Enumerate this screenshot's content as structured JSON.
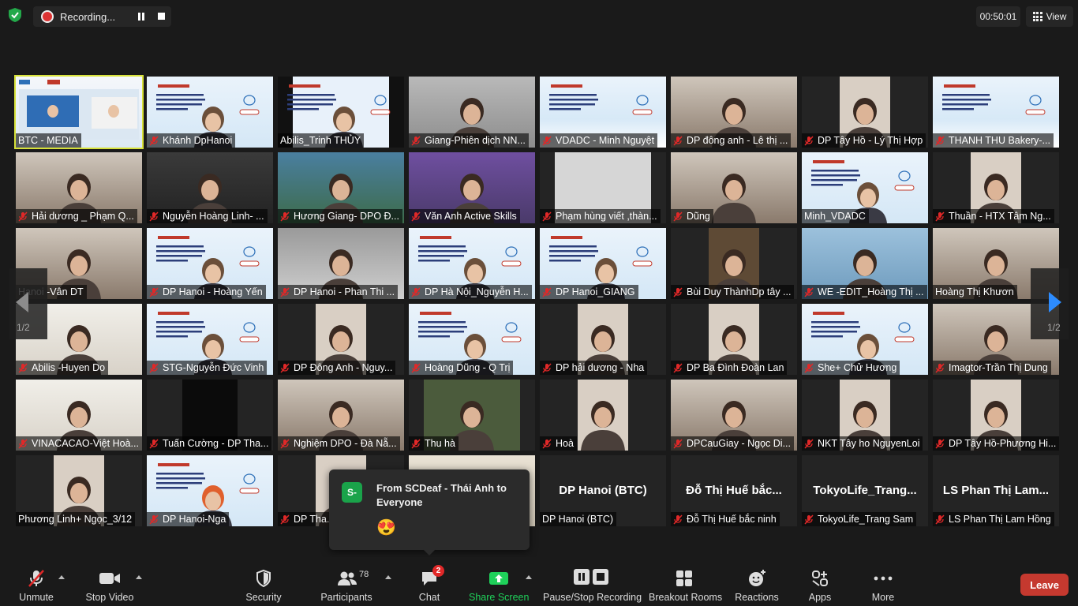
{
  "recording": {
    "label": "Recording..."
  },
  "timer": "00:50:01",
  "view_label": "View",
  "grid": {
    "page_indicator_left": "1/2",
    "page_indicator_right": "1/2",
    "tiles": [
      {
        "name": "BTC - MEDIA",
        "muted": false,
        "style": "slide-dual",
        "active": true
      },
      {
        "name": "Khánh DpHanoi",
        "muted": true,
        "style": "slide-person"
      },
      {
        "name": "Abilis_Trinh THỦY",
        "muted": false,
        "style": "slide-person-dark"
      },
      {
        "name": "Giang-Phiên dịch NN...",
        "muted": true,
        "style": "person-grey"
      },
      {
        "name": "VDADC - Minh Nguyệt",
        "muted": true,
        "style": "slide"
      },
      {
        "name": "DP đông anh - Lê thị ...",
        "muted": true,
        "style": "person-room"
      },
      {
        "name": "DP Tây Hồ - Lý Thị Hợp",
        "muted": true,
        "style": "person-small"
      },
      {
        "name": "THANH THU Bakery-...",
        "muted": true,
        "style": "slide"
      },
      {
        "name": "Hải dương _ Phạm Q...",
        "muted": true,
        "style": "person-room"
      },
      {
        "name": "Nguyễn Hoàng Linh- ...",
        "muted": true,
        "style": "person-dark"
      },
      {
        "name": "Hương Giang- DPO Đ...",
        "muted": true,
        "style": "person-nature"
      },
      {
        "name": "Văn Anh Active Skills",
        "muted": true,
        "style": "person-purple"
      },
      {
        "name": "Phạm hùng viết ,thàn...",
        "muted": true,
        "style": "wall"
      },
      {
        "name": "Dũng",
        "muted": true,
        "style": "person-room"
      },
      {
        "name": "Minh_VDADC",
        "muted": false,
        "style": "slide-person"
      },
      {
        "name": "Thuần - HTX Tâm Ng...",
        "muted": true,
        "style": "person-small"
      },
      {
        "name": "Hanoi -Vân DT",
        "muted": false,
        "style": "person-room"
      },
      {
        "name": "DP Hanoi - Hoàng Yến",
        "muted": true,
        "style": "slide-person"
      },
      {
        "name": "DP Hanoi - Phan Thi ...",
        "muted": true,
        "style": "bed"
      },
      {
        "name": "DP Hà Nội_Nguyễn H...",
        "muted": true,
        "style": "slide-person"
      },
      {
        "name": "DP Hanoi_GIANG",
        "muted": true,
        "style": "slide-person"
      },
      {
        "name": "Bùi Duy ThànhDp tây ...",
        "muted": true,
        "style": "dark-door"
      },
      {
        "name": "WE -EDIT_Hoàng Thị ...",
        "muted": true,
        "style": "person-blue"
      },
      {
        "name": "Hoàng Thị Khươn",
        "muted": false,
        "style": "person-room"
      },
      {
        "name": "Abilis -Huyen Do",
        "muted": true,
        "style": "person-light"
      },
      {
        "name": "STG-Nguyễn Đức Vinh",
        "muted": true,
        "style": "slide-person"
      },
      {
        "name": "DP Đông Anh - Nguy...",
        "muted": true,
        "style": "person-small"
      },
      {
        "name": "Hoàng Dũng - Q Trị",
        "muted": true,
        "style": "slide-person"
      },
      {
        "name": "DP hải dương - Nha",
        "muted": true,
        "style": "person-small"
      },
      {
        "name": "DP Ba Đình Đoàn Lan",
        "muted": true,
        "style": "person-small"
      },
      {
        "name": "She+ Chử Hương",
        "muted": true,
        "style": "slide-person"
      },
      {
        "name": "Imagtor-Trần Thị Dung",
        "muted": true,
        "style": "person-room"
      },
      {
        "name": "VINACACAO-Việt Hoà...",
        "muted": true,
        "style": "person-light"
      },
      {
        "name": "Tuấn Cường - DP Tha...",
        "muted": true,
        "style": "dark-center"
      },
      {
        "name": "Nghiệm DPO - Đà Nẵ...",
        "muted": true,
        "style": "person-room"
      },
      {
        "name": "Thu hà",
        "muted": true,
        "style": "person-green"
      },
      {
        "name": "Hoà",
        "muted": true,
        "style": "person-small"
      },
      {
        "name": "DPCauGiay - Ngọc Di...",
        "muted": true,
        "style": "person-room"
      },
      {
        "name": "NKT Tây ho NguyenLoi",
        "muted": true,
        "style": "person-small"
      },
      {
        "name": "DP Tây Hồ-Phương Hi...",
        "muted": true,
        "style": "person-small"
      },
      {
        "name": "Phương Linh+ Ngọc_3/12",
        "muted": false,
        "style": "person-small"
      },
      {
        "name": "DP Hanoi-Nga",
        "muted": true,
        "style": "slide-person-red"
      },
      {
        "name": "DP Tha...",
        "muted": true,
        "style": "person-small"
      },
      {
        "name": "",
        "muted": false,
        "style": "photo-wall"
      },
      {
        "name": "DP Hanoi (BTC)",
        "muted": false,
        "style": "blank",
        "big": "DP Hanoi (BTC)"
      },
      {
        "name": "Đỗ Thị Huế bắc ninh",
        "muted": true,
        "style": "blank",
        "big": "Đỗ Thị Huế bắc..."
      },
      {
        "name": "TokyoLife_Trang Sam",
        "muted": true,
        "style": "blank",
        "big": "TokyoLife_Trang..."
      },
      {
        "name": "LS Phan Thị Lam Hồng",
        "muted": true,
        "style": "blank",
        "big": "LS Phan Thị Lam..."
      }
    ]
  },
  "chat_popup": {
    "avatar_letter": "S-",
    "title": "From SCDeaf - Thái Anh to Everyone",
    "emoji": "😍"
  },
  "toolbar": {
    "unmute": "Unmute",
    "stop_video": "Stop Video",
    "security": "Security",
    "participants": "Participants",
    "participants_count": "78",
    "chat": "Chat",
    "chat_badge": "2",
    "share_screen": "Share Screen",
    "pause_stop_recording": "Pause/Stop Recording",
    "breakout_rooms": "Breakout Rooms",
    "reactions": "Reactions",
    "apps": "Apps",
    "more": "More",
    "leave": "Leave"
  },
  "colors": {
    "background": "#1a1a1a",
    "active_speaker": "#d8e23a",
    "share_green": "#1fd15a",
    "leave_red": "#c5392f",
    "nav_blue": "#2d8cff"
  }
}
